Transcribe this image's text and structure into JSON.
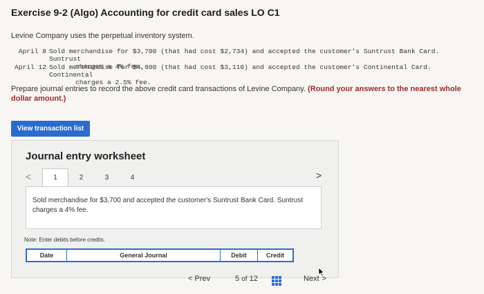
{
  "title": "Exercise 9-2 (Algo) Accounting for credit card sales LO C1",
  "intro": "Levine Company uses the perpetual inventory system.",
  "transactions": [
    {
      "date": "April 8",
      "line1": "Sold merchandise for $3,700 (that had cost $2,734) and accepted the customer's Suntrust Bank Card. Suntrust",
      "line2": "charges a 4% fee."
    },
    {
      "date": "April 12",
      "line1": "Sold merchandise for $4,800 (that had cost $3,110) and accepted the customer's Continental Card. Continental",
      "line2": "charges a 2.5% fee."
    }
  ],
  "instructions": {
    "text": "Prepare journal entries to record the above credit card transactions of Levine Company.",
    "emphasis": "(Round your answers to the nearest whole dollar amount.)"
  },
  "view_button_label": "View transaction list",
  "worksheet": {
    "title": "Journal entry worksheet",
    "prev_chevron": "<",
    "next_chevron": ">",
    "tabs": [
      "1",
      "2",
      "3",
      "4"
    ],
    "active_tab": "1",
    "description": "Sold merchandise for $3,700 and accepted the customer's Suntrust Bank Card. Suntrust charges a 4% fee.",
    "note": "Note: Enter debits before credits.",
    "columns": {
      "date": "Date",
      "general_journal": "General Journal",
      "debit": "Debit",
      "credit": "Credit"
    }
  },
  "footer": {
    "prev_label": "Prev",
    "prev_chevron": "<",
    "current_page": "5",
    "of_label": "of",
    "total_pages": "12",
    "next_label": "Next",
    "next_chevron": ">"
  },
  "colors": {
    "accent": "#2b6bd0",
    "emphasis": "#a12a2a"
  }
}
